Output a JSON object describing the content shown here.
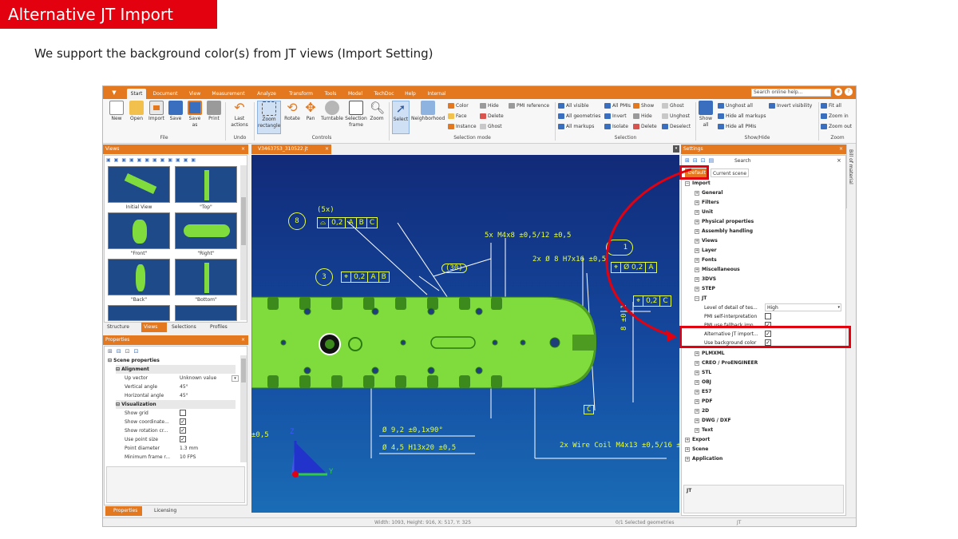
{
  "slide": {
    "title": "Alternative JT Import",
    "subtitle": "We support the background color(s) from JT views (Import Setting)"
  },
  "menu": {
    "tabs": [
      "Start",
      "Document",
      "View",
      "Measurement",
      "Analyze",
      "Transform",
      "Tools",
      "Model",
      "TechDoc",
      "Help",
      "Internal"
    ],
    "active_tab": "Start",
    "search_placeholder": "Search online help..."
  },
  "ribbon": {
    "file_buttons": [
      "New",
      "Open",
      "Import",
      "Save",
      "Save as",
      "Print"
    ],
    "undo_button": "Last actions",
    "controls_buttons": [
      "Zoom rectangle",
      "Rotate",
      "Pan",
      "Turntable",
      "Selection frame",
      "Zoom"
    ],
    "select_button": "Select",
    "neighborhood_button": "Neighborhood",
    "selection_mode_items": [
      "Color",
      "Face",
      "Instance",
      "Hide",
      "Delete",
      "Ghost",
      "PMI reference"
    ],
    "selection_items": [
      "All visible",
      "All geometries",
      "All markups",
      "All PMIs",
      "Invert",
      "Isolate",
      "Show",
      "Hide",
      "Delete",
      "Ghost",
      "Unghost",
      "Deselect"
    ],
    "show_all_button": "Show all",
    "showhide_items": [
      "Unghost all",
      "Hide all markups",
      "Hide all PMIs",
      "Invert visibility"
    ],
    "zoom_items": [
      "Fit all",
      "Zoom in",
      "Zoom out"
    ],
    "groups": [
      "File",
      "Undo",
      "Controls",
      "Selection mode",
      "Selection",
      "Show/Hide",
      "Zoom"
    ]
  },
  "views_panel": {
    "title": "Views",
    "thumbnails": [
      "Initial View",
      "\"Top\"",
      "\"Front\"",
      "\"Right\"",
      "\"Back\"",
      "\"Bottom\""
    ],
    "tabs": [
      "Structure",
      "Views",
      "Selections",
      "Profiles"
    ],
    "active_tab": "Views"
  },
  "properties_panel": {
    "title": "Properties",
    "section": "Scene properties",
    "groups": [
      {
        "name": "Alignment",
        "rows": [
          {
            "key": "Up vector",
            "value": "Unknown value"
          },
          {
            "key": "Vertical angle",
            "value": "45°"
          },
          {
            "key": "Horizontal angle",
            "value": "45°"
          }
        ]
      },
      {
        "name": "Visualization",
        "rows": [
          {
            "key": "Show grid",
            "checked": false
          },
          {
            "key": "Show coordinate...",
            "checked": true
          },
          {
            "key": "Show rotation cr...",
            "checked": true
          },
          {
            "key": "Use point size",
            "checked": true
          },
          {
            "key": "Point diameter",
            "value": "1.3 mm"
          },
          {
            "key": "Minimum frame r...",
            "value": "10 FPS"
          }
        ]
      }
    ],
    "tabs": [
      "Properties",
      "Licensing"
    ],
    "active_tab": "Properties"
  },
  "document": {
    "tab": "V3463753_310522.jt"
  },
  "viewport_annotations": {
    "label8": "8",
    "count5x": "(5x)",
    "fcf1": [
      "⌓",
      "0,2",
      "A",
      "B",
      "C"
    ],
    "dim1": "5x  M4x8  ±0,5/12  ±0,5",
    "dim2": "2x Ø 8  H7x16  ±0,5",
    "label1": "1",
    "fcf2": [
      "⌖",
      "Ø 0,2",
      "A"
    ],
    "dim30": "(30)",
    "label3": "3",
    "fcf3": [
      "⌖",
      "0,2",
      "A",
      "B"
    ],
    "fcf4": [
      "⌖",
      "0,2",
      "C"
    ],
    "dim_left": "±0,5",
    "dim3": "Ø 9,2  ±0,1x90°",
    "dim4": "Ø 4,5 H13x20  ±0,5",
    "dim5": "2x Wire Coil  M4x13  ±0,5/16  ±0,5",
    "dim8": "8 ±0,1",
    "labelC": "C",
    "axis_z": "Z",
    "axis_y": "Y"
  },
  "settings_panel": {
    "title": "Settings",
    "search_label": "Search",
    "tabs": [
      "Default",
      "Current scene"
    ],
    "active_tab": "Default",
    "import_label": "Import",
    "import_children": [
      "General",
      "Filters",
      "Unit",
      "Physical properties",
      "Assembly handling",
      "Views",
      "Layer",
      "Fonts",
      "Miscellaneous",
      "3DVS",
      "STEP"
    ],
    "jt_label": "JT",
    "jt_settings": [
      {
        "key": "Level of detail of tes...",
        "value": "High"
      },
      {
        "key": "PMI self-interpretation",
        "checked": false
      },
      {
        "key": "PMI use fallback imp...",
        "checked": true
      },
      {
        "key": "Alternative JT import...",
        "checked": true
      },
      {
        "key": "Use background color",
        "checked": true
      }
    ],
    "formats_after": [
      "PLMXML",
      "CREO / ProENGINEER",
      "STL",
      "OBJ",
      "E57",
      "PDF",
      "2D",
      "DWG / DXF",
      "Text"
    ],
    "top_level_after": [
      "Export",
      "Scene",
      "Application"
    ],
    "description_box": "JT",
    "side_tab": "Bill of material"
  },
  "statusbar": {
    "dimensions": "Width: 1093, Height: 916, X: 517, Y: 325",
    "selected": "0/1 Selected geometries",
    "format": "JT"
  },
  "colors": {
    "accent": "#e3781e",
    "highlight": "#e3000f",
    "part_green": "#7fdc3c",
    "annotation_yellow": "#e6ff3a",
    "viewport_blue": "#144aa0"
  }
}
